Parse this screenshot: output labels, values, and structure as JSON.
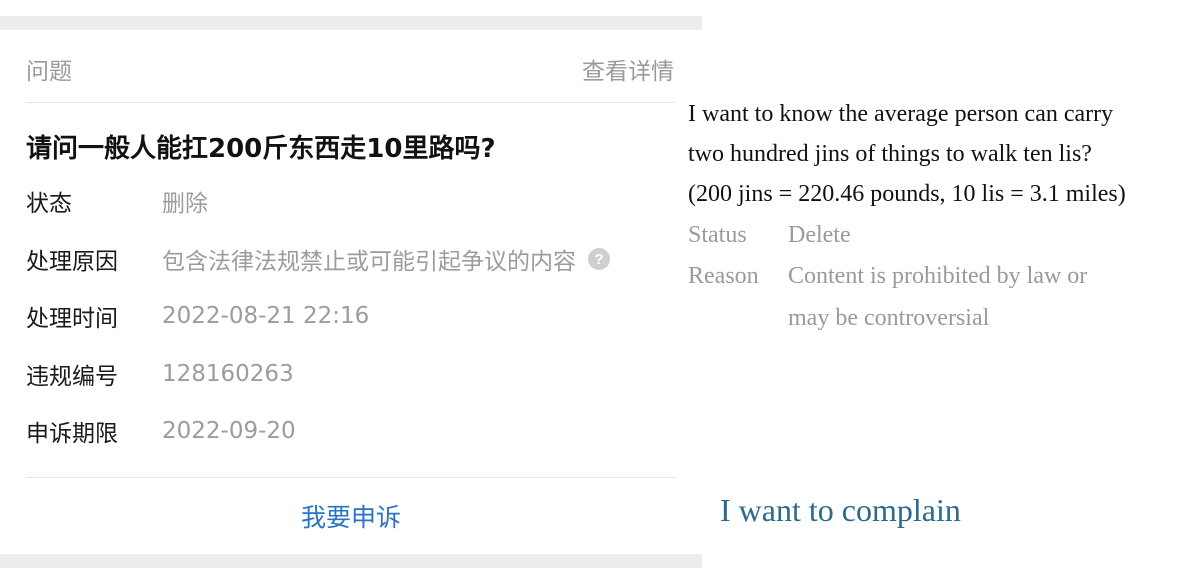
{
  "card": {
    "header_left": "问题",
    "header_right": "查看详情",
    "question": "请问一般人能扛200斤东西走10里路吗?",
    "rows": [
      {
        "label": "状态",
        "value": "删除"
      },
      {
        "label": "处理原因",
        "value": "包含法律法规禁止或可能引起争议的内容"
      },
      {
        "label": "处理时间",
        "value": "2022-08-21 22:16"
      },
      {
        "label": "违规编号",
        "value": "128160263"
      },
      {
        "label": "申诉期限",
        "value": "2022-09-20"
      }
    ],
    "help_icon_glyph": "?",
    "appeal_button": "我要申诉"
  },
  "translation": {
    "question_lines": [
      "I want to know the average person can carry",
      "two hundred jins of things to walk ten lis?",
      "(200 jins = 220.46 pounds, 10 lis = 3.1 miles)"
    ],
    "status_label": "Status",
    "status_value": "Delete",
    "reason_label": "Reason",
    "reason_lines": [
      "Content is prohibited by law or",
      "may be controversial"
    ],
    "complain": "I want to complain"
  },
  "colors": {
    "link_blue": "#2a73c4",
    "translation_blue": "#2a6a8a",
    "muted_gray": "#9c9c9c",
    "band_gray": "#ededed"
  }
}
